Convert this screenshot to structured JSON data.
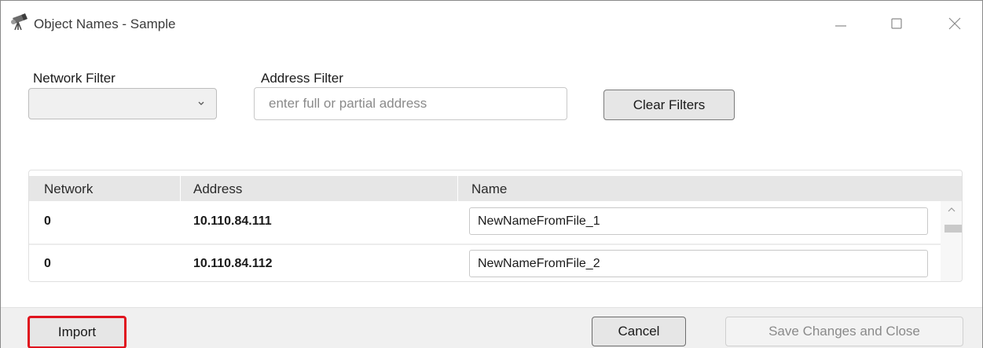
{
  "window": {
    "title": "Object Names - Sample",
    "controls": {
      "minimize": "minimize-icon",
      "maximize": "maximize-icon",
      "close": "close-icon"
    },
    "app_icon": "telescope-icon"
  },
  "filters": {
    "network_label": "Network Filter",
    "network_value": "",
    "address_label": "Address Filter",
    "address_value": "",
    "address_placeholder": "enter full or partial address",
    "clear_label": "Clear Filters"
  },
  "grid": {
    "columns": [
      "Network",
      "Address",
      "Name"
    ],
    "rows": [
      {
        "network": "0",
        "address": "10.110.84.111",
        "name": "NewNameFromFile_1"
      },
      {
        "network": "0",
        "address": "10.110.84.112",
        "name": "NewNameFromFile_2"
      }
    ]
  },
  "footer": {
    "import_label": "Import",
    "cancel_label": "Cancel",
    "save_label": "Save Changes and Close"
  },
  "colors": {
    "highlight_border": "#e0141e",
    "header_bg": "#e6e6e6",
    "footer_bg": "#f0f0f0"
  }
}
